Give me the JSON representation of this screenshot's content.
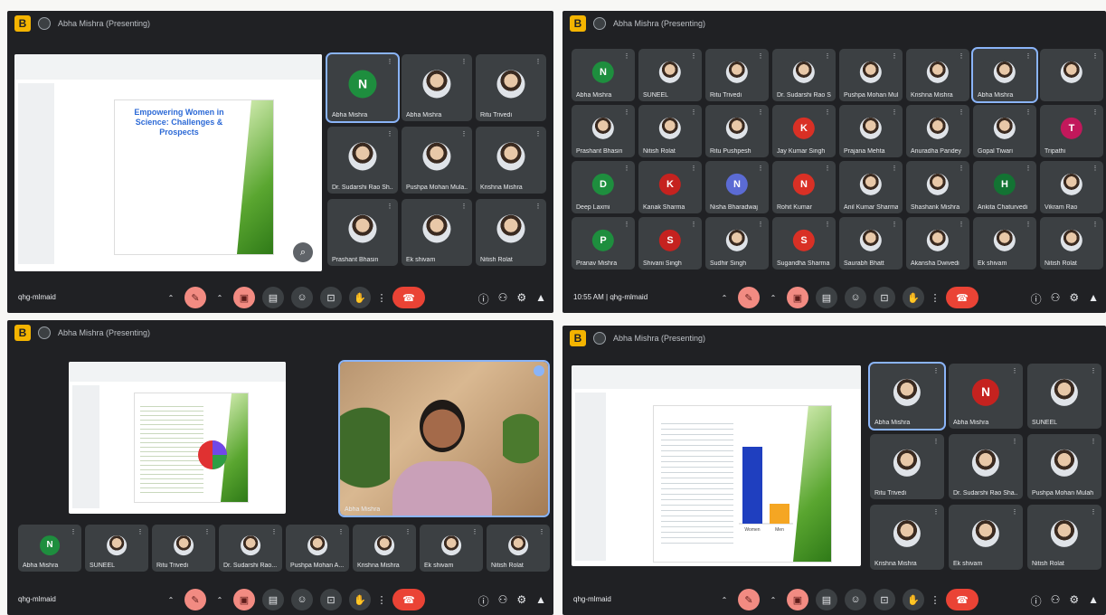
{
  "logo_letter": "B",
  "colors": {
    "accent": "#8ab4f8",
    "end_call": "#ea4335",
    "mic_off": "#f28b82",
    "app_bg": "#202124"
  },
  "icons": [
    "mic-off-icon",
    "camera-off-icon",
    "captions-icon",
    "emoji-icon",
    "present-icon",
    "raise-hand-icon",
    "more-icon",
    "end-call-icon",
    "info-icon",
    "people-icon",
    "activities-icon",
    "host-controls-icon"
  ],
  "panel1": {
    "title": "Abha Mishra (Presenting)",
    "meeting_code": "qhg-mlmaid",
    "slide_title": "Empowering Women in Science: Challenges & Prospects",
    "participants": [
      {
        "name": "Abha Mishra",
        "initial": "N"
      },
      {
        "name": "Abha Mishra"
      },
      {
        "name": "Ritu Trivedi"
      },
      {
        "name": "Dr. Sudarshi Rao Sh..."
      },
      {
        "name": "Pushpa Mohan Mula..."
      },
      {
        "name": "Krishna Mishra"
      },
      {
        "name": "Prashant Bhasin"
      },
      {
        "name": "Ek shivam"
      },
      {
        "name": "Nitish Rolat"
      }
    ]
  },
  "panel2": {
    "title": "Abha Mishra (Presenting)",
    "meeting_code": "qhg-mlmaid",
    "time": "10:55 AM",
    "participants": [
      {
        "name": "Abha Mishra",
        "initial": "N"
      },
      {
        "name": "SUNEEL"
      },
      {
        "name": "Ritu Trivedi"
      },
      {
        "name": "Dr. Sudarshi Rao Sh..."
      },
      {
        "name": "Pushpa Mohan Mula..."
      },
      {
        "name": "Krishna Mishra"
      },
      {
        "name": "Abha Mishra"
      },
      {
        "name": ""
      },
      {
        "name": "Prashant Bhasin"
      },
      {
        "name": "Nitish Rolat"
      },
      {
        "name": "Ritu Pushpesh"
      },
      {
        "name": "Jay Kumar Singh",
        "initial": "K"
      },
      {
        "name": "Prajana Mehta"
      },
      {
        "name": "Anuradha Pandey"
      },
      {
        "name": "Gopal Tiwari"
      },
      {
        "name": "Tripathi",
        "initial": "T"
      },
      {
        "name": "Deep Laxmi",
        "initial": "D"
      },
      {
        "name": "Kanak Sharma",
        "initial": "K"
      },
      {
        "name": "Nisha Bharadwaj",
        "initial": "N"
      },
      {
        "name": "Rohit Kumar",
        "initial": "N"
      },
      {
        "name": "Anil Kumar Sharma"
      },
      {
        "name": "Shashank Mishra"
      },
      {
        "name": "Ankita Chaturvedi",
        "initial": "H"
      },
      {
        "name": "Vikram Rao"
      },
      {
        "name": "Pranav Mishra",
        "initial": "P"
      },
      {
        "name": "Shivani Singh",
        "initial": "S"
      },
      {
        "name": "Sudhir Singh"
      },
      {
        "name": "Sugandha Sharma",
        "initial": "S"
      },
      {
        "name": "Saurabh Bhatt"
      },
      {
        "name": "Akansha Dwivedi"
      },
      {
        "name": "Ek shivam"
      },
      {
        "name": "Nitish Rolat"
      }
    ]
  },
  "panel3": {
    "title": "Abha Mishra (Presenting)",
    "meeting_code": "qhg-mlmaid",
    "speaker_name": "Abha Mishra",
    "participants": [
      {
        "name": "Abha Mishra",
        "initial": "N"
      },
      {
        "name": "SUNEEL"
      },
      {
        "name": "Ritu Trivedi"
      },
      {
        "name": "Dr. Sudarshi Rao..."
      },
      {
        "name": "Pushpa Mohan A..."
      },
      {
        "name": "Krishna Mishra"
      },
      {
        "name": "Ek shivam"
      },
      {
        "name": "Nitish Rolat"
      }
    ]
  },
  "panel4": {
    "title": "Abha Mishra (Presenting)",
    "meeting_code": "qhg-mlmaid",
    "chart_data": {
      "type": "bar",
      "categories": [
        "Women",
        "Men"
      ],
      "values": [
        85,
        22
      ],
      "title": "",
      "xlabel": "",
      "ylabel": ""
    },
    "participants": [
      {
        "name": "Abha Mishra"
      },
      {
        "name": "Abha Mishra",
        "initial": "N"
      },
      {
        "name": "SUNEEL"
      },
      {
        "name": "Ritu Trivedi"
      },
      {
        "name": "Dr. Sudarshi Rao Sha..."
      },
      {
        "name": "Pushpa Mohan Mulah"
      },
      {
        "name": "Krishna Mishra"
      },
      {
        "name": "Ek shivam"
      },
      {
        "name": "Nitish Rolat"
      }
    ]
  }
}
